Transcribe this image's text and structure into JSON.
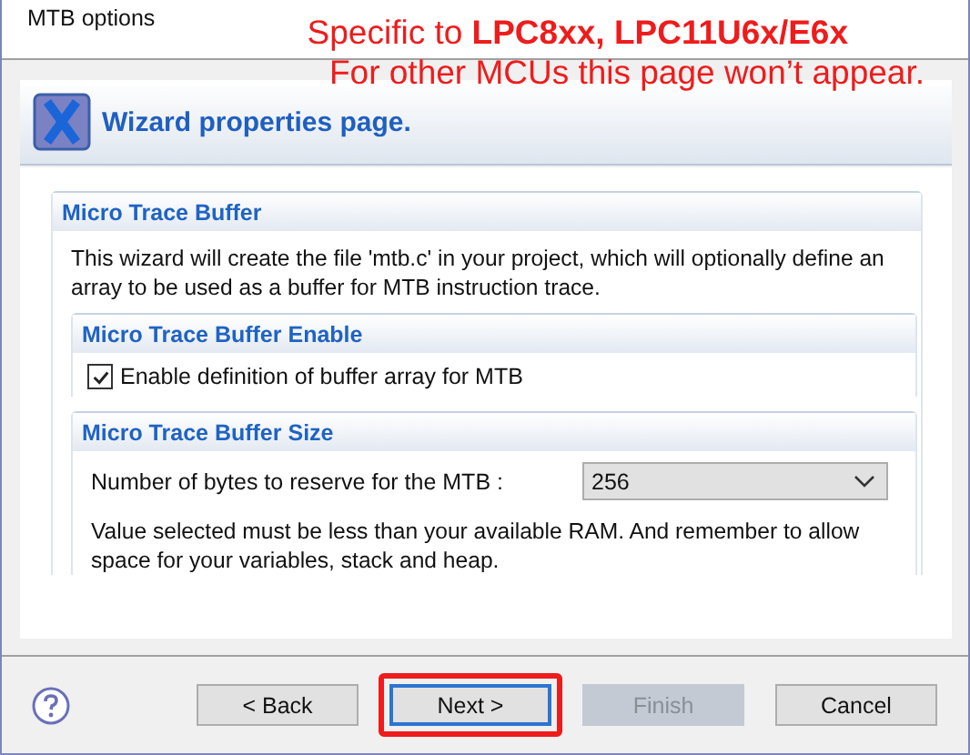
{
  "window": {
    "title": "MTB options"
  },
  "annotation": {
    "lines": [
      "Specific to **LPC8xx, LPC11U6x/E6x**",
      "For other MCUs this page won’t appear."
    ]
  },
  "header": {
    "title": "Wizard properties page."
  },
  "section": {
    "title": "Micro Trace Buffer",
    "description": "This wizard will create the file 'mtb.c' in your project, which will optionally define an array to be used as a buffer for MTB instruction trace.",
    "groups": [
      {
        "kind": "checkbox",
        "title": "Micro Trace Buffer Enable",
        "label": "Enable definition of buffer array for MTB",
        "checked": true
      },
      {
        "kind": "select",
        "title": "Micro Trace Buffer Size",
        "label": "Number of bytes to reserve for the MTB :",
        "value": "256",
        "note": "Value selected must be less than your available RAM. And remember to allow space for your variables, stack and heap."
      }
    ]
  },
  "buttons": [
    {
      "label": "< Back",
      "disabled": false,
      "focused": false,
      "highlighted": false
    },
    {
      "label": "Next >",
      "disabled": false,
      "focused": true,
      "highlighted": true
    },
    {
      "label": "Finish",
      "disabled": true,
      "focused": false,
      "highlighted": false
    },
    {
      "label": "Cancel",
      "disabled": false,
      "focused": false,
      "highlighted": false
    }
  ]
}
